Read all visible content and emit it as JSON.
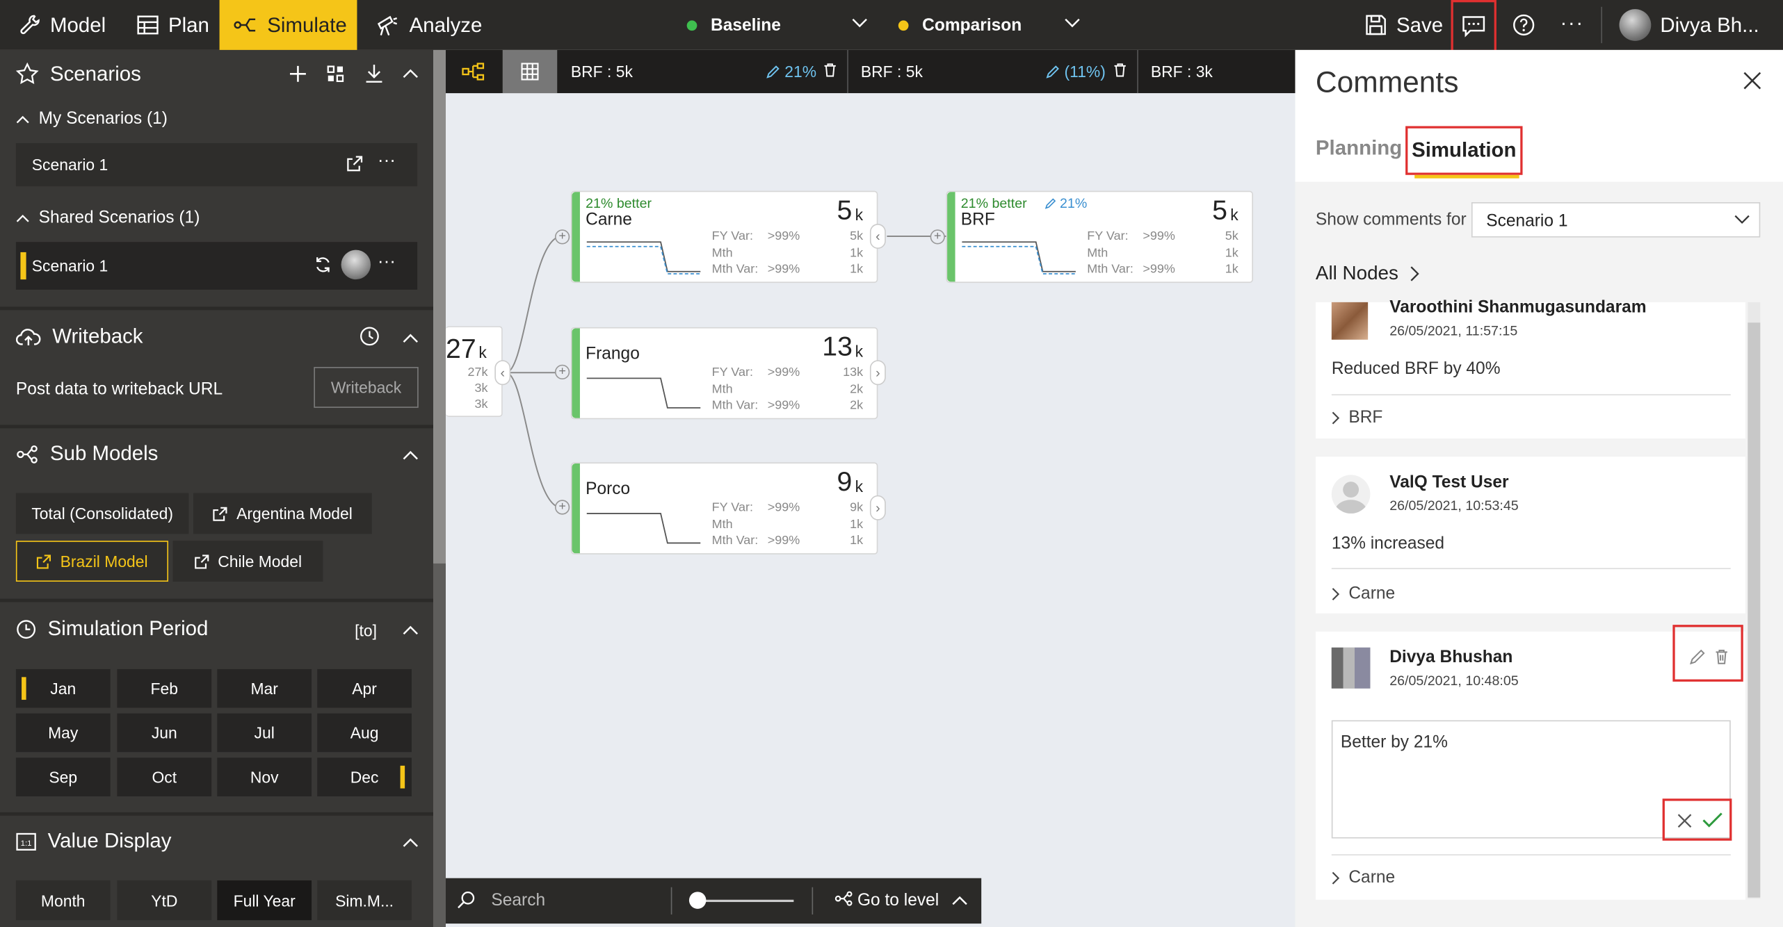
{
  "topbar": {
    "nav": [
      {
        "label": "Model",
        "icon": "wrench-icon"
      },
      {
        "label": "Plan",
        "icon": "table-icon"
      },
      {
        "label": "Simulate",
        "icon": "simulate-icon"
      },
      {
        "label": "Analyze",
        "icon": "analyze-icon"
      }
    ],
    "baseline_label": "Baseline",
    "comparison_label": "Comparison",
    "save_label": "Save",
    "more_label": "···",
    "user_name": "Divya Bh...",
    "colors": {
      "accent": "#f5c518",
      "baseline_dot": "#3fbf4f",
      "comparison_dot": "#f5c518",
      "highlight": "#e03030"
    }
  },
  "sidebar": {
    "scenarios": {
      "title": "Scenarios",
      "my_header": "My Scenarios (1)",
      "my_items": [
        "Scenario 1"
      ],
      "shared_header": "Shared Scenarios (1)",
      "shared_items": [
        "Scenario 1"
      ]
    },
    "writeback": {
      "title": "Writeback",
      "description": "Post data to writeback URL",
      "button": "Writeback"
    },
    "submodels": {
      "title": "Sub Models",
      "items": [
        "Total (Consolidated)",
        "Argentina Model",
        "Brazil Model",
        "Chile Model"
      ],
      "selected": "Brazil Model"
    },
    "period": {
      "title": "Simulation Period",
      "suffix": "[to]",
      "months": [
        "Jan",
        "Feb",
        "Mar",
        "Apr",
        "May",
        "Jun",
        "Jul",
        "Aug",
        "Sep",
        "Oct",
        "Nov",
        "Dec"
      ],
      "from": "Jan",
      "to": "Dec"
    },
    "value_display": {
      "title": "Value Display",
      "options": [
        "Month",
        "YtD",
        "Full Year",
        "Sim.M..."
      ],
      "selected": "Full Year"
    }
  },
  "canvas": {
    "tabs": [
      {
        "label": "BRF : 5k",
        "change": "21%"
      },
      {
        "label": "BRF : 5k",
        "change": "(11%)"
      },
      {
        "label": "BRF : 3k",
        "change": ""
      }
    ],
    "root": {
      "value": "27",
      "unit": "k",
      "rows": [
        "27k",
        "3k",
        "3k"
      ]
    },
    "nodes": [
      {
        "id": "carne",
        "name": "Carne",
        "badge": "21% better",
        "badge_change": "",
        "value": "5",
        "unit": "k",
        "labels": [
          "FY Var:",
          "Mth",
          "Mth Var:"
        ],
        "pcts": [
          ">99%",
          "",
          ">99%"
        ],
        "nums": [
          "5k",
          "1k",
          "1k"
        ]
      },
      {
        "id": "brf",
        "name": "BRF",
        "badge": "21% better",
        "badge_change": "21%",
        "value": "5",
        "unit": "k",
        "labels": [
          "FY Var:",
          "Mth",
          "Mth Var:"
        ],
        "pcts": [
          ">99%",
          "",
          ">99%"
        ],
        "nums": [
          "5k",
          "1k",
          "1k"
        ]
      },
      {
        "id": "frango",
        "name": "Frango",
        "badge": "",
        "badge_change": "",
        "value": "13",
        "unit": "k",
        "labels": [
          "FY Var:",
          "Mth",
          "Mth Var:"
        ],
        "pcts": [
          ">99%",
          "",
          ">99%"
        ],
        "nums": [
          "13k",
          "2k",
          "2k"
        ]
      },
      {
        "id": "porco",
        "name": "Porco",
        "badge": "",
        "badge_change": "",
        "value": "9",
        "unit": "k",
        "labels": [
          "FY Var:",
          "Mth",
          "Mth Var:"
        ],
        "pcts": [
          ">99%",
          "",
          ">99%"
        ],
        "nums": [
          "9k",
          "1k",
          "1k"
        ]
      }
    ],
    "search_placeholder": "Search",
    "zoom": 0.05,
    "goto_label": "Go to level"
  },
  "comments": {
    "title": "Comments",
    "tabs": [
      "Planning",
      "Simulation"
    ],
    "active_tab": "Simulation",
    "filter_label": "Show comments for",
    "filter_value": "Scenario 1",
    "breadcrumb": "All Nodes",
    "items": [
      {
        "author": "Varoothini Shanmugasundaram",
        "date": "26/05/2021, 11:57:15",
        "text": "Reduced BRF by 40%",
        "node": "BRF"
      },
      {
        "author": "ValQ Test User",
        "date": "26/05/2021, 10:53:45",
        "text": "13% increased",
        "node": "Carne"
      },
      {
        "author": "Divya Bhushan",
        "date": "26/05/2021, 10:48:05",
        "text": "Better by 21%",
        "node": "Carne"
      }
    ]
  }
}
